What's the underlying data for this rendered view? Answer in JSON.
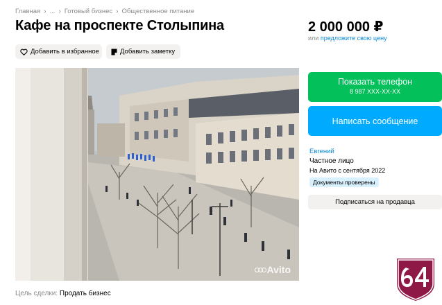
{
  "breadcrumbs": [
    "Главная",
    "...",
    "Готовый бизнес",
    "Общественное питание"
  ],
  "listing": {
    "title": "Кафе на проспекте Столыпина",
    "price": "2 000 000 ₽",
    "price_or": "или",
    "price_offer_link": "предложите свою цену"
  },
  "actions": {
    "favorite_label": "Добавить в избранное",
    "note_label": "Добавить заметку"
  },
  "contact": {
    "phone_button_label": "Показать телефон",
    "phone_masked": "8 987 XXX-XX-XX",
    "message_button_label": "Написать сообщение"
  },
  "seller": {
    "name": "Евгений",
    "type": "Частное лицо",
    "since": "На Авито с сентября 2022",
    "verified_badge": "Документы проверены",
    "subscribe_label": "Подписаться на продавца"
  },
  "deal": {
    "label": "Цель сделки:",
    "value": "Продать бизнес"
  },
  "photo": {
    "watermark": "Avito"
  },
  "colors": {
    "green": "#04c05a",
    "blue": "#00aaff",
    "link": "#0a8ad8",
    "chip_bg": "#f2f1f0",
    "badge_bg": "#d9f0ff",
    "logo": "#8e1846"
  },
  "icons": {
    "favorite": "heart-outline-icon",
    "note": "note-icon",
    "breadcrumb_separator": "chevron-right-icon"
  }
}
